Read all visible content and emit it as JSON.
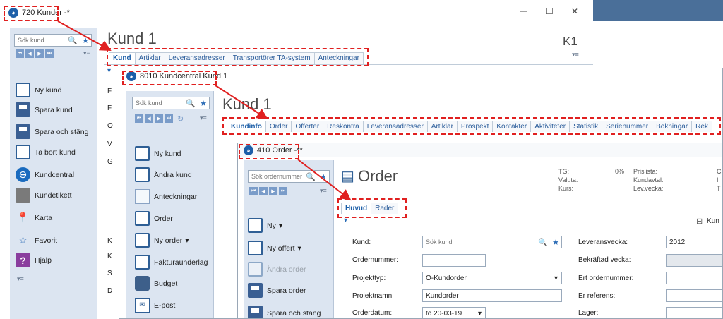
{
  "window_kunder": {
    "title": "720 Kunder -*",
    "heading": "Kund 1",
    "corner_code": "K1",
    "search_placeholder": "Sök kund",
    "tabs": [
      "Kund",
      "Artiklar",
      "Leveransadresser",
      "Transportörer TA-system",
      "Anteckningar"
    ],
    "actions": [
      {
        "label": "Ny kund",
        "icon": "new-document-icon"
      },
      {
        "label": "Spara kund",
        "icon": "save-icon"
      },
      {
        "label": "Spara och stäng",
        "icon": "save-close-icon"
      },
      {
        "label": "Ta bort kund",
        "icon": "delete-document-icon"
      },
      {
        "label": "Kundcentral",
        "icon": "globe-icon"
      },
      {
        "label": "Kundetikett",
        "icon": "label-icon"
      },
      {
        "label": "Karta",
        "icon": "map-pin-icon"
      },
      {
        "label": "Favorit",
        "icon": "star-icon"
      },
      {
        "label": "Hjälp",
        "icon": "help-icon"
      }
    ],
    "row_initials": [
      "F",
      "F",
      "O",
      "V",
      "G",
      "K",
      "K",
      "S",
      "D"
    ]
  },
  "window_kundcentral": {
    "title": "8010 Kundcentral Kund 1",
    "heading": "Kund 1",
    "search_placeholder": "Sök kund",
    "tabs": [
      "Kundinfo",
      "Order",
      "Offerter",
      "Reskontra",
      "Leveransadresser",
      "Artiklar",
      "Prospekt",
      "Kontakter",
      "Aktiviteter",
      "Statistik",
      "Serienummer",
      "Bokningar",
      "Rek"
    ],
    "actions": [
      {
        "label": "Ny kund",
        "icon": "new-document-icon"
      },
      {
        "label": "Ändra kund",
        "icon": "edit-document-icon"
      },
      {
        "label": "Anteckningar",
        "icon": "notes-icon"
      },
      {
        "label": "Order",
        "icon": "new-document-icon"
      },
      {
        "label": "Ny order",
        "icon": "new-document-icon",
        "dropdown": "▾"
      },
      {
        "label": "Fakturaunderlag",
        "icon": "new-document-icon"
      },
      {
        "label": "Budget",
        "icon": "briefcase-icon"
      },
      {
        "label": "E-post",
        "icon": "mail-icon"
      }
    ]
  },
  "window_order": {
    "title": "410 Order -**",
    "heading": "Order",
    "search_placeholder": "Sök ordernummer",
    "tabs": [
      "Huvud",
      "Rader"
    ],
    "actions": [
      {
        "label": "Ny",
        "icon": "new-document-icon",
        "dropdown": "▾"
      },
      {
        "label": "Ny offert",
        "icon": "edit-document-icon",
        "dropdown": "▾"
      },
      {
        "label": "Ändra order",
        "icon": "edit-document-icon",
        "disabled": true
      },
      {
        "label": "Spara order",
        "icon": "save-icon"
      },
      {
        "label": "Spara och stäng",
        "icon": "save-close-icon"
      }
    ],
    "info": {
      "tg_label": "TG:",
      "tg_value": "0%",
      "valuta_label": "Valuta:",
      "kurs_label": "Kurs:",
      "prislista_label": "Prislista:",
      "kundavtal_label": "Kundavtal:",
      "levvecka_label": "Lev.vecka:",
      "cut_1": "C",
      "cut_2": "I",
      "cut_3": "T"
    },
    "toolbar_cut": "Kun",
    "form_left": [
      {
        "label": "Kund:",
        "value": "",
        "placeholder": "Sök kund"
      },
      {
        "label": "Ordernummer:",
        "value": ""
      },
      {
        "label": "Projekttyp:",
        "value": "O-Kundorder"
      },
      {
        "label": "Projektnamn:",
        "value": "Kundorder"
      },
      {
        "label": "Orderdatum:",
        "value": "to 20-03-19"
      }
    ],
    "form_right": [
      {
        "label": "Leveransvecka:",
        "value": "2012"
      },
      {
        "label": "Bekräftad vecka:",
        "value": ""
      },
      {
        "label": "Ert ordernummer:",
        "value": ""
      },
      {
        "label": "Er referens:",
        "value": ""
      },
      {
        "label": "Lager:",
        "value": ""
      }
    ]
  },
  "window_controls": {
    "minimize": "—",
    "maximize": "☐",
    "close": "✕"
  },
  "glyphs": {
    "search": "🔍",
    "star": "★",
    "chevron": "▾",
    "menu": "▾≡",
    "filter": "⚲"
  },
  "colors": {
    "annotation": "#e02020",
    "sidebar": "#dce5f1",
    "tab_text": "#2a5c9a",
    "app_blue": "#1d5fa8"
  }
}
